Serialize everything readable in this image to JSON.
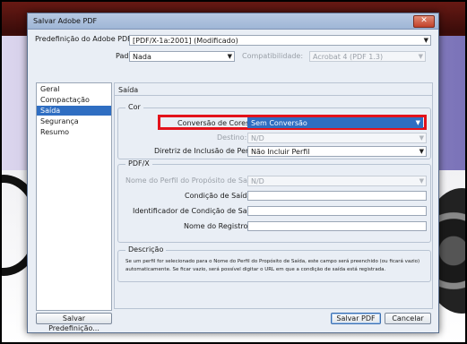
{
  "window": {
    "title": "Salvar Adobe PDF",
    "close_glyph": "✕"
  },
  "preset": {
    "label": "Predefinição do Adobe PDF:",
    "value": "[PDF/X-1a:2001] (Modificado)"
  },
  "standard": {
    "label": "Padrão:",
    "value": "Nada"
  },
  "compatibility": {
    "label": "Compatibilidade:",
    "value": "Acrobat 4 (PDF 1.3)"
  },
  "sidebar": {
    "items": [
      {
        "label": "Geral",
        "selected": false
      },
      {
        "label": "Compactação",
        "selected": false
      },
      {
        "label": "Saída",
        "selected": true
      },
      {
        "label": "Segurança",
        "selected": false
      },
      {
        "label": "Resumo",
        "selected": false
      }
    ]
  },
  "section": {
    "title": "Saída"
  },
  "color_group": {
    "title": "Cor",
    "conversion": {
      "label": "Conversão de Cores:",
      "value": "Sem Conversão"
    },
    "destination": {
      "label": "Destino:",
      "value": "N/D"
    },
    "profile_policy": {
      "label": "Diretriz de Inclusão de Perfil:",
      "value": "Não Incluir Perfil"
    }
  },
  "pdfx_group": {
    "title": "PDF/X",
    "output_intent_profile": {
      "label": "Nome do Perfil do Propósito de Saída:",
      "value": "N/D"
    },
    "output_condition": {
      "label": "Condição de Saída:",
      "value": ""
    },
    "output_condition_id": {
      "label": "Identificador de Condição de Saída:",
      "value": ""
    },
    "registry_name": {
      "label": "Nome do Registro:",
      "value": ""
    }
  },
  "description": {
    "title": "Descrição",
    "text": "Se um perfil for selecionado para o Nome do Perfil do Propósito de Saída, este campo será preenchido (ou ficará vazio) automaticamente. Se ficar vazio, será possível digitar o URL em que a condição de saída está registrada."
  },
  "buttons": {
    "save_preset": "Salvar Predefinição...",
    "save_pdf": "Salvar PDF",
    "cancel": "Cancelar"
  },
  "colors": {
    "highlight": "#e3121b",
    "selection": "#2f6ec2"
  },
  "icons": {
    "dropdown": "▼"
  }
}
